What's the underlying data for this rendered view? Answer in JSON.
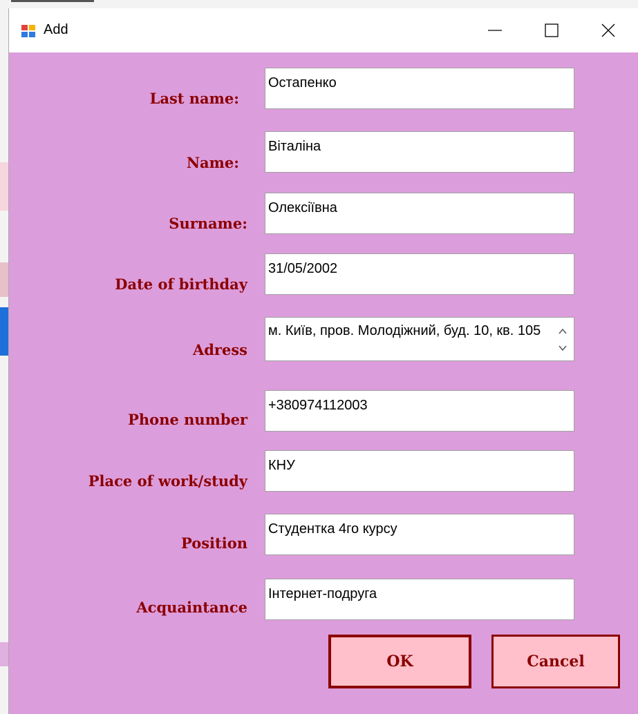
{
  "window": {
    "title": "Add",
    "icon": "form-app-icon",
    "controls": [
      "minimize-icon",
      "maximize-icon",
      "close-icon"
    ]
  },
  "form": {
    "fields": [
      {
        "label": "Last name:",
        "value": "Остапенко"
      },
      {
        "label": "Name:",
        "value": "Віталіна"
      },
      {
        "label": "Surname:",
        "value": "Олексіївна"
      },
      {
        "label": "Date of birthday",
        "value": "31/05/2002"
      },
      {
        "label": "Adress",
        "value": "м. Київ, пров. Молодіжний, буд. 10, кв. 105"
      },
      {
        "label": "Phone number",
        "value": "+380974112003"
      },
      {
        "label": "Place of work/study",
        "value": "КНУ"
      },
      {
        "label": "Position",
        "value": "Студентка 4го курсу"
      },
      {
        "label": "Acquaintance",
        "value": "Інтернет-подруга"
      }
    ]
  },
  "buttons": {
    "ok_label": "OK",
    "cancel_label": "Cancel"
  },
  "colors": {
    "background": "#dc9ddc",
    "label_text": "#8b0000",
    "button_fill": "#ffc0cb",
    "button_border": "#8b0000"
  }
}
